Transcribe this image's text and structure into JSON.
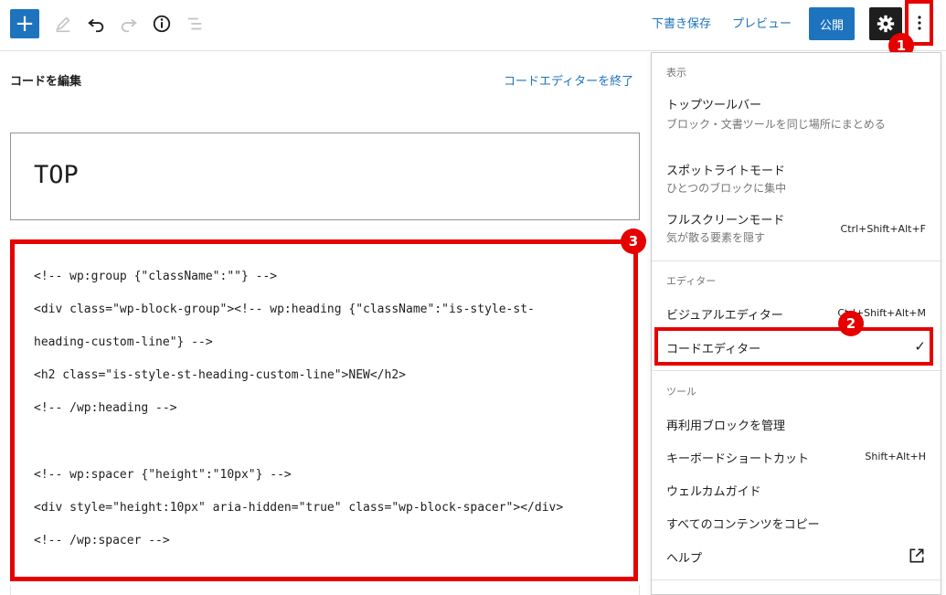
{
  "toolbar": {
    "add_label": "+",
    "save_draft_label": "下書き保存",
    "preview_label": "プレビュー",
    "publish_label": "公開"
  },
  "editor": {
    "code_header": "コードを編集",
    "exit_code_editor": "コードエディターを終了",
    "title": "TOP",
    "code_lines": [
      "<!-- wp:group {\"className\":\"\"} -->",
      "<div class=\"wp-block-group\"><!-- wp:heading {\"className\":\"is-style-st-",
      "heading-custom-line\"} -->",
      "<h2 class=\"is-style-st-heading-custom-line\">NEW</h2>",
      "<!-- /wp:heading -->",
      "",
      "<!-- wp:spacer {\"height\":\"10px\"} -->",
      "<div style=\"height:10px\" aria-hidden=\"true\" class=\"wp-block-spacer\"></div>",
      "<!-- /wp:spacer -->"
    ]
  },
  "markers": {
    "m1": "1",
    "m2": "2",
    "m3": "3"
  },
  "menu": {
    "view_title": "表示",
    "top_toolbar": {
      "label": "トップツールバー",
      "desc": "ブロック・文書ツールを同じ場所にまとめる"
    },
    "spotlight": {
      "label": "スポットライトモード",
      "desc": "ひとつのブロックに集中"
    },
    "fullscreen": {
      "label": "フルスクリーンモード",
      "desc": "気が散る要素を隠す",
      "shortcut": "Ctrl+Shift+Alt+F"
    },
    "editor_title": "エディター",
    "visual_editor": {
      "label": "ビジュアルエディター",
      "shortcut": "Ctrl+Shift+Alt+M"
    },
    "code_editor": {
      "label": "コードエディター",
      "check": "✓"
    },
    "tools_title": "ツール",
    "manage_blocks": {
      "label": "再利用ブロックを管理"
    },
    "shortcuts": {
      "label": "キーボードショートカット",
      "shortcut": "Shift+Alt+H"
    },
    "welcome": {
      "label": "ウェルカムガイド"
    },
    "copy_all": {
      "label": "すべてのコンテンツをコピー"
    },
    "help": {
      "label": "ヘルプ"
    }
  },
  "colors": {
    "accent": "#1e73be",
    "annotation_red": "#e60000",
    "dark": "#1e1e1e"
  },
  "icons": {
    "add": "plus-icon",
    "edit": "pencil-icon",
    "undo": "undo-icon",
    "redo": "redo-icon",
    "info": "info-icon",
    "outline": "list-view-icon",
    "settings": "gear-icon",
    "more": "vertical-ellipsis-icon",
    "external": "external-link-icon"
  }
}
